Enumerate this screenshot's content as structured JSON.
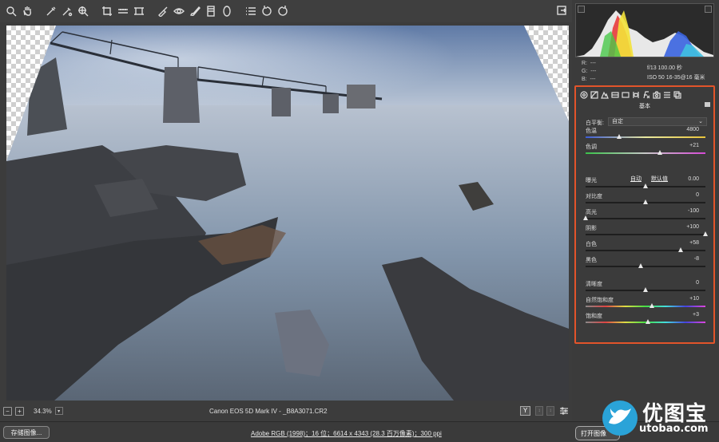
{
  "toolbar": {
    "tools": [
      "zoom-icon",
      "hand-icon",
      "white-balance-icon",
      "color-sampler-icon",
      "target-adjustment-icon",
      "crop-icon",
      "straighten-icon",
      "transform-icon",
      "spot-removal-icon",
      "red-eye-icon",
      "adjustment-brush-icon",
      "graduated-filter-icon",
      "radial-filter-icon",
      "preferences-list-icon",
      "rotate-left-icon",
      "rotate-right-icon"
    ]
  },
  "status": {
    "zoom": "34.3%",
    "filename": "Canon EOS 5D Mark IV - _B8A3071.CR2",
    "y_label": "Y"
  },
  "bottom": {
    "save_label": "存储图像...",
    "workflow": "Adobe RGB (1998)；16 位；6614 x 4343 (28.3 百万像素)；300 ppi",
    "open_label": "打开图像"
  },
  "watermark": {
    "cn": "优图宝",
    "en": "utobao.com"
  },
  "readout": {
    "r_label": "R:",
    "r_val": "---",
    "g_label": "G:",
    "g_val": "---",
    "b_label": "B:",
    "b_val": "---",
    "aperture_shutter": "f/13   100.00 秒",
    "iso_lens": "ISO 50    16-35@16 毫米"
  },
  "panel": {
    "section_title": "基本",
    "wb_label": "白平衡:",
    "wb_value": "自定",
    "auto_label": "自动",
    "default_label": "默认值",
    "sliders": [
      {
        "label": "色温",
        "value": "4800",
        "pos": 0.28
      },
      {
        "label": "色调",
        "value": "+21",
        "pos": 0.62
      },
      {
        "label": "曝光",
        "value": "0.00",
        "pos": 0.5
      },
      {
        "label": "对比度",
        "value": "0",
        "pos": 0.5
      },
      {
        "label": "高光",
        "value": "-100",
        "pos": 0.0
      },
      {
        "label": "阴影",
        "value": "+100",
        "pos": 1.0
      },
      {
        "label": "白色",
        "value": "+58",
        "pos": 0.79
      },
      {
        "label": "黑色",
        "value": "-8",
        "pos": 0.46
      },
      {
        "label": "清晰度",
        "value": "0",
        "pos": 0.5
      },
      {
        "label": "自然饱和度",
        "value": "+10",
        "pos": 0.55
      },
      {
        "label": "饱和度",
        "value": "+3",
        "pos": 0.52
      }
    ]
  },
  "colors": {
    "highlight_border": "#e2542a",
    "watermark_bird": "#2aa3d8"
  }
}
